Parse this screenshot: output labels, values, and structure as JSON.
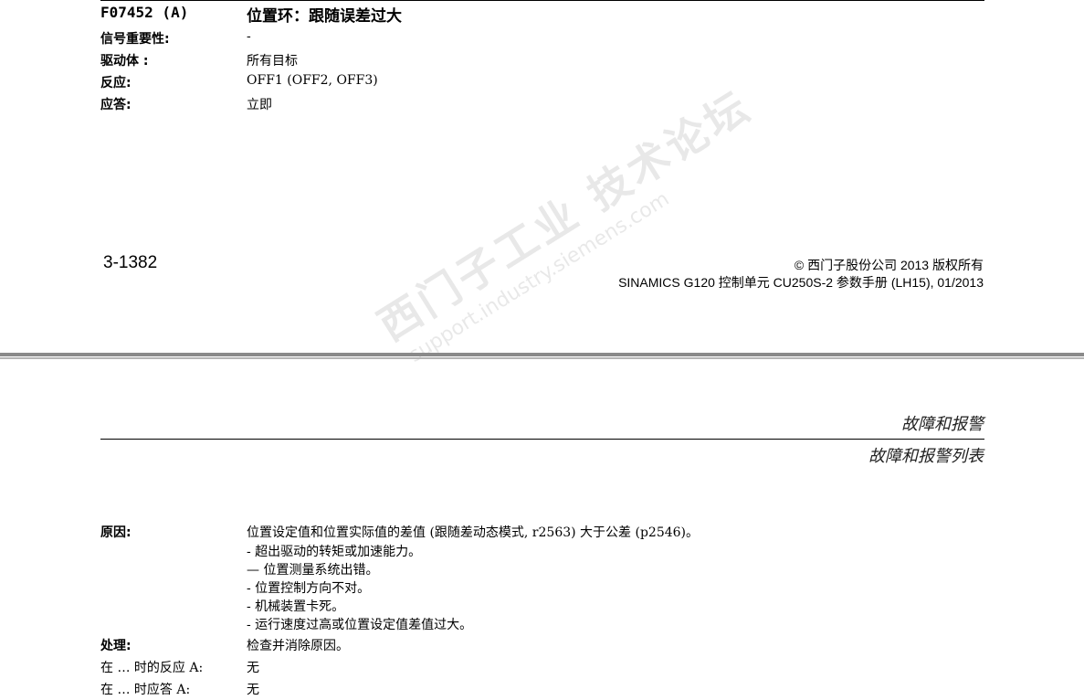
{
  "fault": {
    "code": "F07452 (A)",
    "title": "位置环：跟随误差过大"
  },
  "fields_top": [
    {
      "label": "信号重要性:",
      "value": "-"
    },
    {
      "label": "驱动体 :",
      "value": "所有目标"
    },
    {
      "label": "反应:",
      "value": "OFF1 (OFF2, OFF3)"
    },
    {
      "label": "应答:",
      "value": "立即"
    }
  ],
  "footer": {
    "page_number": "3-1382",
    "copyright": "© 西门子股份公司 2013 版权所有",
    "manual": "SINAMICS G120 控制单元  CU250S-2 参数手册 (LH15), 01/2013"
  },
  "header": {
    "section": "故障和报警",
    "subsection": "故障和报警列表"
  },
  "watermark": {
    "line1": "西门子工业 技术论坛",
    "line2": "support.industry.siemens.com"
  },
  "cause": {
    "label": "原因:",
    "lines": [
      "位置设定值和位置实际值的差值 (跟随差动态模式, r2563) 大于公差 (p2546)。",
      "- 超出驱动的转矩或加速能力。",
      "— 位置测量系统出错。",
      "- 位置控制方向不对。",
      "- 机械装置卡死。",
      "- 运行速度过高或位置设定值差值过大。"
    ]
  },
  "remedy": {
    "label": "处理:",
    "value": "检查并消除原因。"
  },
  "reaction_on_a": {
    "label": "在 … 时的反应 A:",
    "value": "无"
  },
  "ack_on_a": {
    "label": "在 … 时应答 A:",
    "value": "无"
  }
}
